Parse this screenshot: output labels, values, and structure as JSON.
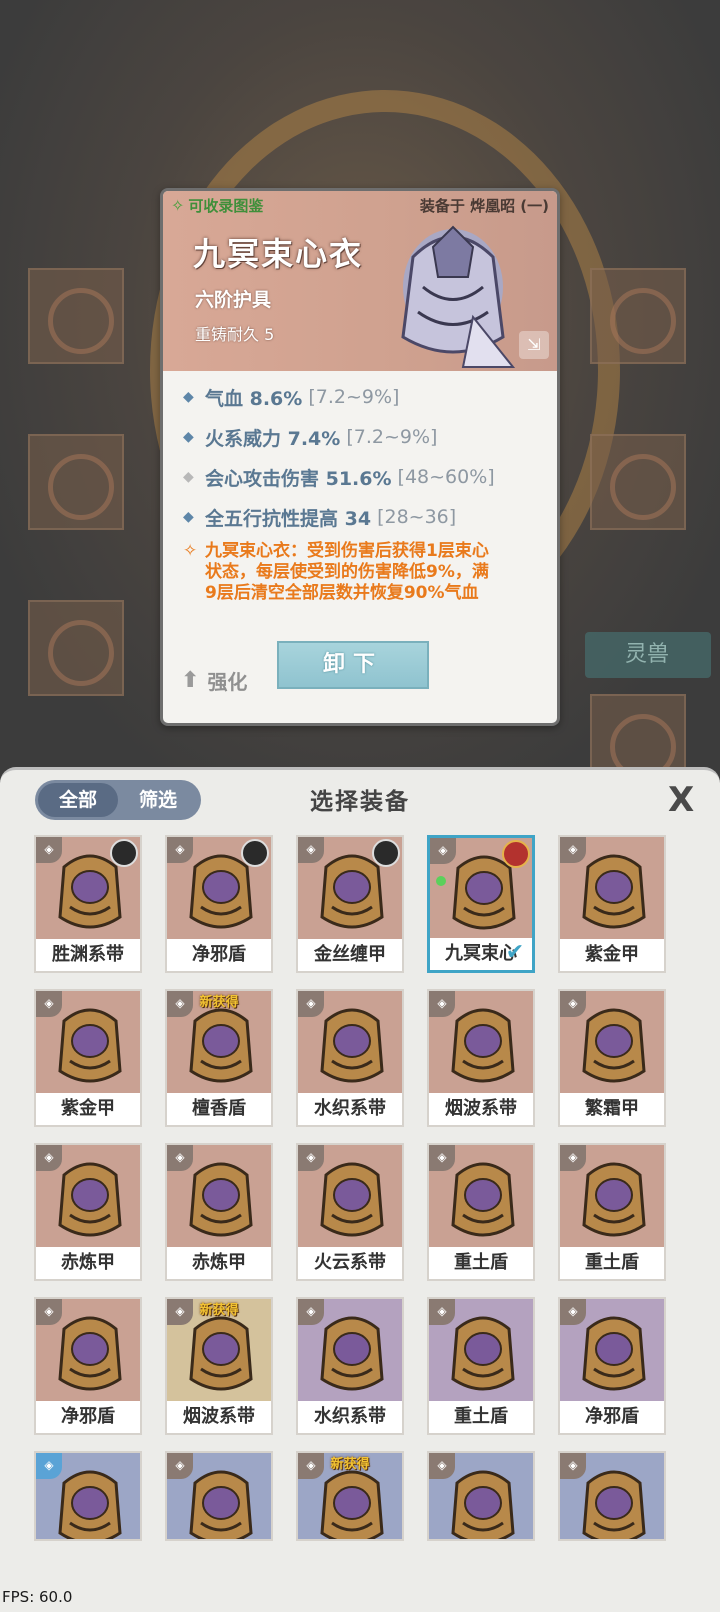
{
  "background": {
    "side_button_label": "灵兽"
  },
  "card": {
    "collect_label": "可收录图鉴",
    "equipped_by": "装备于 烨凰昭 (一)",
    "name": "九冥束心衣",
    "tier": "六阶护具",
    "recast": "重铸耐久 5",
    "stats": [
      {
        "label": "气血 8.6%",
        "range": "[7.2~9%]",
        "marker": "blue"
      },
      {
        "label": "火系威力 7.4%",
        "range": "[7.2~9%]",
        "marker": "blue"
      },
      {
        "label": "会心攻击伤害 51.6%",
        "range": "[48~60%]",
        "marker": "grey"
      },
      {
        "label": "全五行抗性提高 34",
        "range": "[28~36]",
        "marker": "blue"
      }
    ],
    "effect_line1": "九冥束心衣：受到伤害后获得1层束心",
    "effect_line2": "状态，每层使受到的伤害降低9%，满",
    "effect_line3": "9层后清空全部层数并恢复90%气血",
    "enhance_label": "强化",
    "unequip_label": "卸下"
  },
  "panel": {
    "tabs": [
      "全部",
      "筛选"
    ],
    "title": "选择装备",
    "close_label": "X",
    "items": [
      {
        "name": "胜渊系带",
        "color": "#c9a193",
        "avatar": true
      },
      {
        "name": "净邪盾",
        "color": "#c9a193",
        "avatar": true
      },
      {
        "name": "金丝缠甲",
        "color": "#c9a193",
        "avatar": true
      },
      {
        "name": "九冥束心衣",
        "display": "九冥束心",
        "color": "#c9a193",
        "avatar": true,
        "selected": true
      },
      {
        "name": "紫金甲",
        "color": "#c9a193"
      },
      {
        "name": "紫金甲",
        "color": "#c9a193"
      },
      {
        "name": "檀香盾",
        "color": "#c9a193",
        "new": true
      },
      {
        "name": "水织系带",
        "color": "#c9a193"
      },
      {
        "name": "烟波系带",
        "color": "#c9a193"
      },
      {
        "name": "繁霜甲",
        "color": "#c9a193"
      },
      {
        "name": "赤炼甲",
        "color": "#c9a193"
      },
      {
        "name": "赤炼甲",
        "color": "#c9a193"
      },
      {
        "name": "火云系带",
        "color": "#c9a193"
      },
      {
        "name": "重土盾",
        "color": "#c9a193"
      },
      {
        "name": "重土盾",
        "color": "#c9a193"
      },
      {
        "name": "净邪盾",
        "color": "#c9a193"
      },
      {
        "name": "烟波系带",
        "color": "#d4c29c",
        "new": true
      },
      {
        "name": "水织系带",
        "color": "#b4a2bf"
      },
      {
        "name": "重土盾",
        "color": "#b4a2bf"
      },
      {
        "name": "净邪盾",
        "color": "#b4a2bf"
      },
      {
        "name": "",
        "color": "#9ca6c6",
        "blue": true
      },
      {
        "name": "",
        "color": "#9ca6c6"
      },
      {
        "name": "",
        "color": "#9ca6c6",
        "new": true
      },
      {
        "name": "",
        "color": "#9ca6c6"
      },
      {
        "name": "",
        "color": "#9ca6c6"
      }
    ],
    "new_tag": "新获得",
    "check_mark": "✔"
  },
  "fps": "FPS: 60.0"
}
